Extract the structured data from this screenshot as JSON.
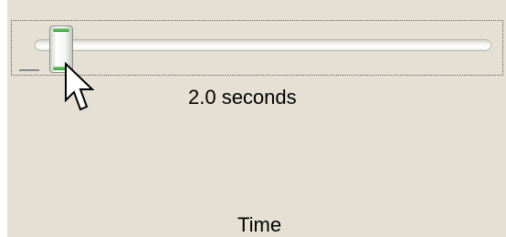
{
  "slider": {
    "name": "Time",
    "value_text": "2.0 seconds",
    "position_fraction": 0.05,
    "colors": {
      "panel": "#e4e0d4",
      "thumb_grip": "#26a526",
      "focus_outline": "#5a5a5a"
    }
  },
  "label": {
    "text": "Time"
  },
  "cursor": {
    "icon": "mouse-pointer-arrow-icon"
  }
}
